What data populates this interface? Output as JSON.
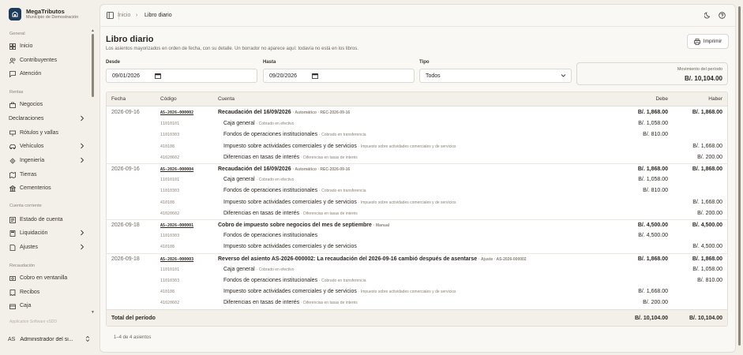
{
  "brand": {
    "name": "MegaTributos",
    "subtitle": "Municipio de Demostración"
  },
  "sidebar": {
    "sections": [
      {
        "title": "General",
        "items": [
          {
            "label": "Inicio",
            "icon": "grid-icon"
          },
          {
            "label": "Contribuyentes",
            "icon": "users-icon"
          },
          {
            "label": "Atención",
            "icon": "chat-icon"
          }
        ]
      },
      {
        "title": "Rentas",
        "items": [
          {
            "label": "Negocios",
            "icon": "briefcase-icon"
          },
          {
            "label": "Declaraciones",
            "icon": "",
            "chevron": true
          },
          {
            "label": "Rótulos y vallas",
            "icon": "sign-icon"
          },
          {
            "label": "Vehículos",
            "icon": "car-icon",
            "chevron": true
          },
          {
            "label": "Ingeniería",
            "icon": "gear-icon",
            "chevron": true
          },
          {
            "label": "Tierras",
            "icon": "map-icon"
          },
          {
            "label": "Cementerios",
            "icon": "building-icon"
          }
        ]
      },
      {
        "title": "Cuenta corriente",
        "items": [
          {
            "label": "Estado de cuenta",
            "icon": "ledger-icon"
          },
          {
            "label": "Liquidación",
            "icon": "calc-icon",
            "chevron": true
          },
          {
            "label": "Ajustes",
            "icon": "adjust-icon",
            "chevron": true
          }
        ]
      },
      {
        "title": "Recaudación",
        "items": [
          {
            "label": "Cobro en ventanilla",
            "icon": "cash-icon"
          },
          {
            "label": "Recibos",
            "icon": "receipt-icon"
          },
          {
            "label": "Caja",
            "icon": "box-icon"
          }
        ]
      }
    ],
    "footer_note": "Application Software vSDD",
    "user": {
      "initials": "AS",
      "name": "Administrador del si..."
    }
  },
  "breadcrumb": {
    "home": "Inicio",
    "current": "Libro diario"
  },
  "page": {
    "title": "Libro diario",
    "subtitle": "Los asientos mayorizados en orden de fecha, con su detalle. Un borrador no aparece aquí: todavía no está en los libros.",
    "print_label": "Imprimir"
  },
  "filters": {
    "desde_label": "Desde",
    "desde_value": "09/01/2026",
    "hasta_label": "Hasta",
    "hasta_value": "09/20/2026",
    "tipo_label": "Tipo",
    "tipo_value": "Todos",
    "movement_label": "Movimiento del período",
    "movement_value": "B/. 10,104.00"
  },
  "table": {
    "headers": {
      "fecha": "Fecha",
      "codigo": "Código",
      "cuenta": "Cuenta",
      "debe": "Debe",
      "haber": "Haber"
    },
    "entries": [
      {
        "fecha": "2026-09-16",
        "codigo": "AS-2026-000002",
        "cuenta": "Recaudación del 16/09/2026",
        "note": "· Automático · REC-2026-09-16",
        "debe": "B/. 1,868.00",
        "haber": "B/. 1,868.00",
        "lines": [
          {
            "codigo": "11010101",
            "cuenta": "Caja general",
            "note": "· Cobrado en efectivo",
            "debe": "B/. 1,058.00",
            "haber": ""
          },
          {
            "codigo": "11010303",
            "cuenta": "Fondos de operaciones institucionales",
            "note": "· Cobrado en transferencia",
            "debe": "B/. 810.00",
            "haber": ""
          },
          {
            "codigo": "410108",
            "cuenta": "Impuesto sobre actividades comerciales y de servicios",
            "note": "· Impuesto sobre actividades comerciales y de servicios",
            "debe": "",
            "haber": "B/. 1,668.00"
          },
          {
            "codigo": "41020602",
            "cuenta": "Diferencias en tasas de interés",
            "note": "· Diferencias en tasas de interés",
            "debe": "",
            "haber": "B/. 200.00"
          }
        ]
      },
      {
        "fecha": "2026-09-16",
        "codigo": "AS-2026-000004",
        "cuenta": "Recaudación del 16/09/2026",
        "note": "· Automático · REC-2026-09-16",
        "debe": "B/. 1,868.00",
        "haber": "B/. 1,868.00",
        "lines": [
          {
            "codigo": "11010101",
            "cuenta": "Caja general",
            "note": "· Cobrado en efectivo",
            "debe": "B/. 1,058.00",
            "haber": ""
          },
          {
            "codigo": "11010303",
            "cuenta": "Fondos de operaciones institucionales",
            "note": "· Cobrado en transferencia",
            "debe": "B/. 810.00",
            "haber": ""
          },
          {
            "codigo": "410108",
            "cuenta": "Impuesto sobre actividades comerciales y de servicios",
            "note": "· Impuesto sobre actividades comerciales y de servicios",
            "debe": "",
            "haber": "B/. 1,668.00"
          },
          {
            "codigo": "41020602",
            "cuenta": "Diferencias en tasas de interés",
            "note": "· Diferencias en tasas de interés",
            "debe": "",
            "haber": "B/. 200.00"
          }
        ]
      },
      {
        "fecha": "2026-09-18",
        "codigo": "AS-2026-000001",
        "cuenta": "Cobro de impuesto sobre negocios del mes de septiembre",
        "note": "· Manual",
        "debe": "B/. 4,500.00",
        "haber": "B/. 4,500.00",
        "lines": [
          {
            "codigo": "11010303",
            "cuenta": "Fondos de operaciones institucionales",
            "note": "",
            "debe": "B/. 4,500.00",
            "haber": ""
          },
          {
            "codigo": "410108",
            "cuenta": "Impuesto sobre actividades comerciales y de servicios",
            "note": "",
            "debe": "",
            "haber": "B/. 4,500.00"
          }
        ]
      },
      {
        "fecha": "2026-09-18",
        "codigo": "AS-2026-000003",
        "cuenta": "Reverso del asiento AS-2026-000002: La recaudación del 2026-09-16 cambió después de asentarse",
        "note": "· Ajuste · AS-2026-000002",
        "debe": "B/. 1,868.00",
        "haber": "B/. 1,868.00",
        "lines": [
          {
            "codigo": "11010101",
            "cuenta": "Caja general",
            "note": "· Cobrado en efectivo",
            "debe": "",
            "haber": "B/. 1,058.00"
          },
          {
            "codigo": "11010303",
            "cuenta": "Fondos de operaciones institucionales",
            "note": "· Cobrado en transferencia",
            "debe": "",
            "haber": "B/. 810.00"
          },
          {
            "codigo": "410108",
            "cuenta": "Impuesto sobre actividades comerciales y de servicios",
            "note": "· Impuesto sobre actividades comerciales y de servicios",
            "debe": "B/. 1,668.00",
            "haber": ""
          },
          {
            "codigo": "41020602",
            "cuenta": "Diferencias en tasas de interés",
            "note": "· Diferencias en tasas de interés",
            "debe": "B/. 200.00",
            "haber": ""
          }
        ]
      }
    ],
    "total": {
      "label": "Total del período",
      "debe": "B/. 10,104.00",
      "haber": "B/. 10,104.00"
    }
  },
  "count_text": "1–4 de 4 asientos"
}
